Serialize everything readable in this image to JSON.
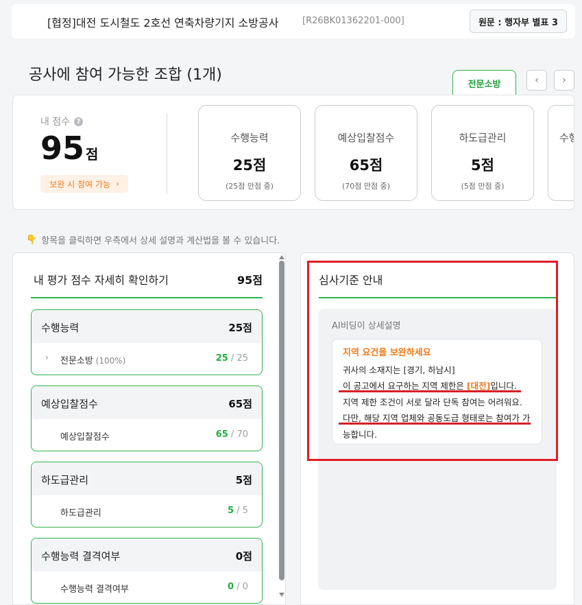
{
  "header": {
    "title": "[협정]대전 도시철도 2호선 연축차량기지 소방공사",
    "code": "[R26BK01362201-000]",
    "source_button": "원문 : 행자부 별표 3"
  },
  "section": {
    "title": "공사에 참여 가능한 조합 (1개)",
    "active_tab": "전문소방",
    "prev_icon": "‹",
    "next_icon": "›"
  },
  "my_score": {
    "label": "내 점수",
    "help": "?",
    "value": "95",
    "unit": "점",
    "badge": "보완 시 참여 가능",
    "badge_arrow": "›"
  },
  "score_cards": [
    {
      "label": "수행능력",
      "value": "25점",
      "sub": "(25점 만점 중)"
    },
    {
      "label": "예상입찰점수",
      "value": "65점",
      "sub": "(70점 만점 중)"
    },
    {
      "label": "하도급관리",
      "value": "5점",
      "sub": "(5점 만점 중)"
    },
    {
      "label": "수행",
      "value": "",
      "sub": ""
    }
  ],
  "hint": {
    "icon": "👇",
    "text": "항목을 클릭하면 우측에서 상세 설명과 계산법을 볼 수 있습니다."
  },
  "detail": {
    "title": "내 평가 점수 자세히 확인하기",
    "total": "95점",
    "groups": [
      {
        "name": "수행능력",
        "score": "25점",
        "row": {
          "chevron": "›",
          "name": "전문소방",
          "pct": " (100%)",
          "got": "25",
          "sep": " / ",
          "max": "25"
        }
      },
      {
        "name": "예상입찰점수",
        "score": "65점",
        "row": {
          "chevron": "",
          "name": "예상입찰점수",
          "pct": "",
          "got": "65",
          "sep": " / ",
          "max": "70"
        }
      },
      {
        "name": "하도급관리",
        "score": "5점",
        "row": {
          "chevron": "",
          "name": "하도급관리",
          "pct": "",
          "got": "5",
          "sep": " / ",
          "max": "5"
        }
      },
      {
        "name": "수행능력 결격여부",
        "score": "0점",
        "row": {
          "chevron": "",
          "name": "수행능력 결격여부",
          "pct": "",
          "got": "0",
          "sep": " / ",
          "max": "0"
        }
      }
    ]
  },
  "guide": {
    "title": "심사기준 안내",
    "ai_label": "AI비딩이 상세설명",
    "card_title": "지역 요건을 보완하세요",
    "line1": "귀사의 소재지는 [경기, 하남시]",
    "line2_pre": "이 공고에서 요구하는 지역 제한은 ",
    "line2_hl": "[대전]",
    "line2_post": "입니다.",
    "line3": "지역 제한 조건이 서로 달라 단독 참여는 어려워요.",
    "line4_pre": "다만, ",
    "line4_ul": "해당 지역 업체와 공동도급 형태로는 참여가 가",
    "line5": "능합니다."
  },
  "colors": {
    "accent_green": "#2eb34b",
    "accent_orange": "#f07a1a",
    "highlight_red": "#e01b24"
  }
}
